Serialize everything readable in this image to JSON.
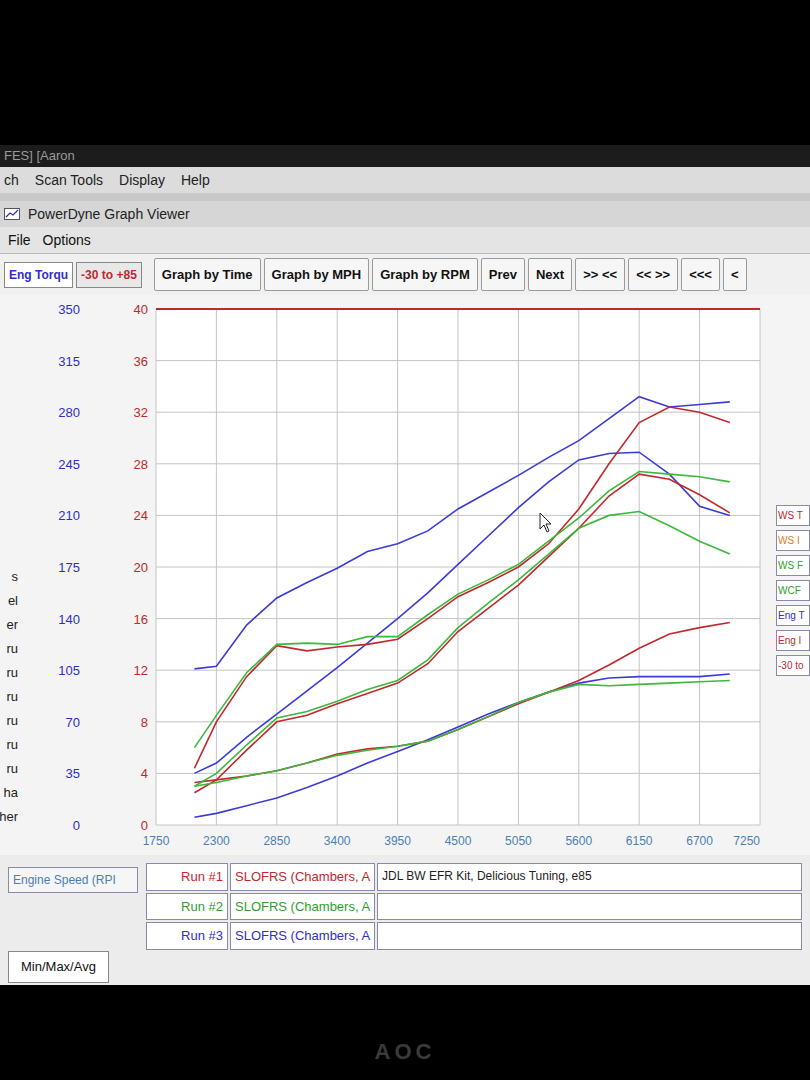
{
  "app": {
    "title": "FES] [Aaron"
  },
  "menubar": [
    "ch",
    "Scan Tools",
    "Display",
    "Help"
  ],
  "window": {
    "title": "PowerDyne Graph Viewer"
  },
  "menu": [
    "File",
    "Options"
  ],
  "tabs": [
    {
      "label": "Eng Torqu",
      "selected": true,
      "color": "#2f2fc8"
    },
    {
      "label": "-30 to +85",
      "selected": false,
      "color": "#c0282d"
    }
  ],
  "buttons": [
    "Graph by Time",
    "Graph by MPH",
    "Graph by RPM",
    "Prev",
    "Next",
    ">> <<",
    "<< >>",
    "<<<",
    "<"
  ],
  "side_labels": [
    "s",
    "el",
    "er",
    "ru",
    "ru",
    "ru",
    "ru",
    "ru",
    "ru",
    "ha",
    "her"
  ],
  "chart": {
    "left_ticks": [
      "350",
      "315",
      "280",
      "245",
      "210",
      "175",
      "140",
      "105",
      "70",
      "35",
      "0"
    ],
    "right_ticks": [
      "40",
      "36",
      "32",
      "28",
      "24",
      "20",
      "16",
      "12",
      "8",
      "4",
      "0"
    ],
    "x_ticks": [
      "1750",
      "2300",
      "2850",
      "3400",
      "3950",
      "4500",
      "5050",
      "5600",
      "6150",
      "6700",
      "7250"
    ],
    "x_min": 1750,
    "x_max": 7250,
    "y_max": 40,
    "rpm": [
      2100,
      2300,
      2575,
      2850,
      3125,
      3400,
      3675,
      3950,
      4225,
      4500,
      4775,
      5050,
      5325,
      5600,
      5875,
      6150,
      6425,
      6700,
      6975
    ],
    "series": [
      {
        "color": "#3b3bd6",
        "values": [
          12.1,
          12.3,
          15.5,
          17.6,
          18.8,
          19.9,
          21.2,
          21.8,
          22.8,
          24.5,
          25.8,
          27.1,
          28.5,
          29.8,
          31.5,
          33.2,
          32.4,
          32.6,
          32.8
        ]
      },
      {
        "color": "#3b3bd6",
        "values": [
          4.0,
          4.8,
          6.8,
          8.6,
          10.4,
          12.2,
          14.1,
          16.0,
          18.0,
          20.2,
          22.4,
          24.6,
          26.6,
          28.3,
          28.8,
          28.9,
          27.2,
          24.7,
          24.0
        ]
      },
      {
        "color": "#3b3bd6",
        "values": [
          0.6,
          0.9,
          1.5,
          2.1,
          2.9,
          3.8,
          4.8,
          5.7,
          6.6,
          7.6,
          8.6,
          9.5,
          10.3,
          11.0,
          11.4,
          11.5,
          11.5,
          11.5,
          11.7
        ]
      },
      {
        "color": "#c0282d",
        "values": [
          4.4,
          8.0,
          11.5,
          13.9,
          13.5,
          13.8,
          14.0,
          14.4,
          16.0,
          17.7,
          18.8,
          20.0,
          21.8,
          24.5,
          28.0,
          31.2,
          32.4,
          32.0,
          31.2
        ]
      },
      {
        "color": "#c0282d",
        "values": [
          2.5,
          3.5,
          5.8,
          8.0,
          8.5,
          9.4,
          10.2,
          11.0,
          12.5,
          15.0,
          16.8,
          18.6,
          20.8,
          23.0,
          25.5,
          27.2,
          26.8,
          25.6,
          24.2
        ]
      },
      {
        "color": "#c0282d",
        "values": [
          3.3,
          3.5,
          3.8,
          4.2,
          4.8,
          5.5,
          5.9,
          6.1,
          6.5,
          7.4,
          8.4,
          9.4,
          10.3,
          11.2,
          12.4,
          13.7,
          14.8,
          15.3,
          15.7
        ]
      },
      {
        "color": "#3cb83c",
        "values": [
          6.0,
          8.5,
          11.8,
          14.0,
          14.1,
          14.0,
          14.6,
          14.6,
          16.3,
          17.9,
          19.0,
          20.2,
          22.0,
          23.8,
          25.9,
          27.4,
          27.2,
          27.0,
          26.6
        ]
      },
      {
        "color": "#3cb83c",
        "values": [
          3.0,
          4.0,
          6.2,
          8.3,
          8.8,
          9.6,
          10.5,
          11.2,
          12.8,
          15.3,
          17.2,
          19.0,
          21.0,
          23.0,
          24.0,
          24.3,
          23.2,
          22.0,
          21.0
        ]
      },
      {
        "color": "#3cb83c",
        "values": [
          3.0,
          3.3,
          3.8,
          4.2,
          4.8,
          5.4,
          5.8,
          6.1,
          6.5,
          7.4,
          8.4,
          9.5,
          10.3,
          10.9,
          10.8,
          10.9,
          11.0,
          11.1,
          11.2
        ]
      }
    ]
  },
  "legend": [
    {
      "label": "WS T",
      "color": "#c0282d"
    },
    {
      "label": "WS I",
      "color": "#e07b1f"
    },
    {
      "label": "WS F",
      "color": "#2f9e2f"
    },
    {
      "label": "WCF",
      "color": "#2f9e2f"
    },
    {
      "label": "Eng T",
      "color": "#2f2fc8"
    },
    {
      "label": "Eng I",
      "color": "#c0282d"
    },
    {
      "label": "-30 to",
      "color": "#c0282d"
    }
  ],
  "axis_label": "Engine Speed (RPI",
  "runs": [
    {
      "label": "Run #1",
      "name": "SLOFRS (Chambers, A",
      "note": "JDL BW EFR Kit, Delicious Tuning, e85",
      "color": "#c0282d"
    },
    {
      "label": "Run #2",
      "name": "SLOFRS (Chambers, A",
      "note": "",
      "color": "#2f9e2f"
    },
    {
      "label": "Run #3",
      "name": "SLOFRS (Chambers, A",
      "note": "",
      "color": "#2f2fc8"
    }
  ],
  "footer_tab": "Min/Max/Avg",
  "monitor": {
    "brand": "AOC"
  }
}
